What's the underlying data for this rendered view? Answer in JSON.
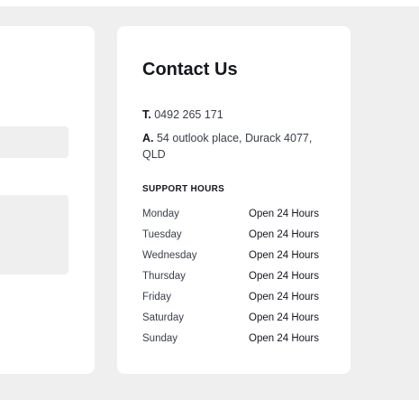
{
  "contact": {
    "title": "Contact Us",
    "phone_prefix": "T.",
    "phone": "0492 265 171",
    "address_prefix": "A.",
    "address": "54 outlook place, Durack 4077, QLD",
    "hours_heading": "SUPPORT HOURS",
    "hours": [
      {
        "day": "Monday",
        "time": "Open 24 Hours"
      },
      {
        "day": "Tuesday",
        "time": "Open 24 Hours"
      },
      {
        "day": "Wednesday",
        "time": "Open 24 Hours"
      },
      {
        "day": "Thursday",
        "time": "Open 24 Hours"
      },
      {
        "day": "Friday",
        "time": "Open 24 Hours"
      },
      {
        "day": "Saturday",
        "time": "Open 24 Hours"
      },
      {
        "day": "Sunday",
        "time": "Open 24 Hours"
      }
    ]
  },
  "colors": {
    "background": "#efefef",
    "card": "#ffffff",
    "heading": "#14171f",
    "body_text": "#3a3f4b"
  }
}
